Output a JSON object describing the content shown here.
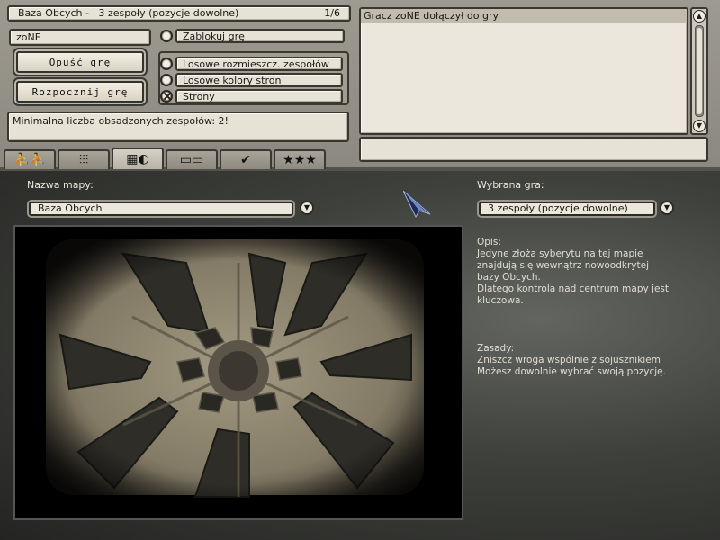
{
  "header": {
    "map_title": "Baza Obcych -",
    "mode": "3 zespoły (pozycje dowolne)",
    "player_count": "1/6"
  },
  "player": {
    "name": "zoNE"
  },
  "buttons": {
    "leave": "Opuść grę",
    "start": "Rozpocznij grę"
  },
  "options": {
    "lock": {
      "label": "Zablokuj grę",
      "checked": false
    },
    "random_placement": {
      "label": "Losowe rozmieszcz. zespołów",
      "checked": false
    },
    "random_colors": {
      "label": "Losowe kolory stron",
      "checked": false
    },
    "sides": {
      "label": "Strony",
      "checked": true
    }
  },
  "info_message": "Minimalna liczba obsadzonych zespołów: 2!",
  "chat": {
    "messages": [
      "Gracz zoNE dołączył do gry"
    ],
    "input_value": ""
  },
  "tabs": [
    {
      "icon": "players-icon",
      "glyph": "⛹⛹",
      "active": false
    },
    {
      "icon": "settings-sliders-icon",
      "glyph": "⫶⫶⫶",
      "active": false
    },
    {
      "icon": "map-globe-icon",
      "glyph": "▦◐",
      "active": true
    },
    {
      "icon": "computers-icon",
      "glyph": "▭▭",
      "active": false
    },
    {
      "icon": "checkmark-icon",
      "glyph": "✔",
      "active": false
    },
    {
      "icon": "stars-icon",
      "glyph": "★★★",
      "active": false
    }
  ],
  "map_select": {
    "label": "Nazwa mapy:",
    "value": "Baza Obcych"
  },
  "game_select": {
    "label": "Wybrana gra:",
    "value": "3 zespoły (pozycje dowolne)"
  },
  "description": {
    "heading": "Opis:",
    "lines": [
      "Jedyne złoża syberytu na tej mapie",
      "znajdują się wewnątrz nowoodkrytej",
      "bazy Obcych.",
      "Dlatego kontrola nad centrum mapy jest",
      "kluczowa."
    ]
  },
  "rules": {
    "heading": "Zasady:",
    "lines": [
      "Zniszcz wroga wspólnie z sojusznikiem",
      "Możesz dowolnie wybrać swoją pozycję."
    ]
  },
  "colors": {
    "panel": "#9d9a91",
    "field": "#e7e2d6",
    "chat_highlight": "#c2bcae",
    "background": "#3e403c",
    "map_sand": "#8b826c"
  }
}
